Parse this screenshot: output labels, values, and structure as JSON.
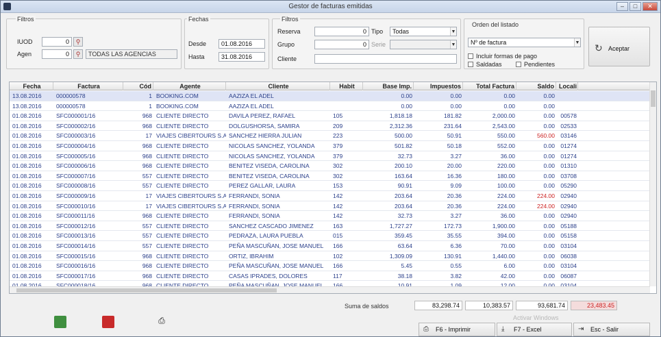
{
  "window": {
    "title": "Gestor de facturas emitidas",
    "min": "–",
    "max": "□",
    "close": "✕"
  },
  "filters": {
    "grupo_titulo": "Filtros",
    "iuod_label": "IUOD",
    "iuod_value": "0",
    "agen_label": "Agen",
    "agen_value": "0",
    "agen_name": "TODAS LAS AGENCIAS",
    "fechas_titulo": "Fechas",
    "desde_label": "Desde",
    "desde_value": "01.08.2016",
    "hasta_label": "Hasta",
    "hasta_value": "31.08.2016",
    "filtro2_titulo": "Filtros",
    "reserva_label": "Reserva",
    "reserva_value": "0",
    "tipo_label": "Tipo",
    "tipo_value": "Todas",
    "grupo_label": "Grupo",
    "grupo_value": "0",
    "serie_label": "Serie",
    "cliente_label": "Cliente",
    "orden_titulo": "Orden del listado",
    "orden_value": "Nº de factura",
    "incluir_label": "Incluir formas de pago",
    "saldadas_label": "Saldadas",
    "pendientes_label": "Pendientes",
    "aceptar_label": "Aceptar"
  },
  "table": {
    "columns": [
      "Fecha",
      "Factura",
      "Cód",
      "Agente",
      "Cliente",
      "Habit",
      "Base Imp.",
      "Impuestos",
      "Total Factura",
      "Saldo",
      "Locali"
    ],
    "rows": [
      [
        "13.08.2016",
        "000000578",
        "1",
        "BOOKING.COM",
        "AAZIZA EL ADEL",
        "",
        "0.00",
        "0.00",
        "0.00",
        "0.00",
        ""
      ],
      [
        "13.08.2016",
        "000000578",
        "1",
        "BOOKING.COM",
        "AAZIZA EL ADEL",
        "",
        "0.00",
        "0.00",
        "0.00",
        "0.00",
        ""
      ],
      [
        "01.08.2016",
        "SFC000001/16",
        "968",
        "CLIENTE DIRECTO",
        "DAVILA PEREZ, RAFAEL",
        "105",
        "1,818.18",
        "181.82",
        "2,000.00",
        "0.00",
        "00578"
      ],
      [
        "01.08.2016",
        "SFC000002/16",
        "968",
        "CLIENTE DIRECTO",
        "DOLGUSHORSA, SAMIRA",
        "209",
        "2,312.36",
        "231.64",
        "2,543.00",
        "0.00",
        "02533"
      ],
      [
        "01.08.2016",
        "SFC000003/16",
        "17",
        "VIAJES CIBERTOURS S.A.",
        "SANCHEZ HIERRA JULIAN",
        "223",
        "500.00",
        "50.91",
        "550.00",
        "560.00",
        "03146"
      ],
      [
        "01.08.2016",
        "SFC000004/16",
        "968",
        "CLIENTE DIRECTO",
        "NICOLAS SANCHEZ, YOLANDA",
        "379",
        "501.82",
        "50.18",
        "552.00",
        "0.00",
        "01274"
      ],
      [
        "01.08.2016",
        "SFC000005/16",
        "968",
        "CLIENTE DIRECTO",
        "NICOLAS SANCHEZ, YOLANDA",
        "379",
        "32.73",
        "3.27",
        "36.00",
        "0.00",
        "01274"
      ],
      [
        "01.08.2016",
        "SFC000006/16",
        "968",
        "CLIENTE DIRECTO",
        "BENITEZ VISEDA, CAROLINA",
        "302",
        "200.10",
        "20.00",
        "220.00",
        "0.00",
        "01310"
      ],
      [
        "01.08.2016",
        "SFC000007/16",
        "557",
        "CLIENTE DIRECTO",
        "BENITEZ VISEDA, CAROLINA",
        "302",
        "163.64",
        "16.36",
        "180.00",
        "0.00",
        "03708"
      ],
      [
        "01.08.2016",
        "SFC000008/16",
        "557",
        "CLIENTE DIRECTO",
        "PEREZ GALLAR, LAURA",
        "153",
        "90.91",
        "9.09",
        "100.00",
        "0.00",
        "05290"
      ],
      [
        "01.08.2016",
        "SFC000009/16",
        "17",
        "VIAJES CIBERTOURS S.A.",
        "FERRANDI, SONIA",
        "142",
        "203.64",
        "20.36",
        "224.00",
        "224.00",
        "02940"
      ],
      [
        "01.08.2016",
        "SFC000010/16",
        "17",
        "VIAJES CIBERTOURS S.A.",
        "FERRANDI, SONIA",
        "142",
        "203.64",
        "20.36",
        "224.00",
        "224.00",
        "02940"
      ],
      [
        "01.08.2016",
        "SFC000011/16",
        "968",
        "CLIENTE DIRECTO",
        "FERRANDI, SONIA",
        "142",
        "32.73",
        "3.27",
        "36.00",
        "0.00",
        "02940"
      ],
      [
        "01.08.2016",
        "SFC000012/16",
        "557",
        "CLIENTE DIRECTO",
        "SANCHEZ CASCADO JIMENEZ",
        "163",
        "1,727.27",
        "172.73",
        "1,900.00",
        "0.00",
        "05188"
      ],
      [
        "01.08.2016",
        "SFC000013/16",
        "557",
        "CLIENTE DIRECTO",
        "PEDRAZA, LAURA PUEBLA",
        "015",
        "359.45",
        "35.55",
        "394.00",
        "0.00",
        "05158"
      ],
      [
        "01.08.2016",
        "SFC000014/16",
        "557",
        "CLIENTE DIRECTO",
        "PEÑA MASCUÑAN, JOSE MANUEL",
        "166",
        "63.64",
        "6.36",
        "70.00",
        "0.00",
        "03104"
      ],
      [
        "01.08.2016",
        "SFC000015/16",
        "968",
        "CLIENTE DIRECTO",
        "ORTIZ, IBRAHIM",
        "102",
        "1,309.09",
        "130.91",
        "1,440.00",
        "0.00",
        "06038"
      ],
      [
        "01.08.2016",
        "SFC000016/16",
        "968",
        "CLIENTE DIRECTO",
        "PEÑA MASCUÑAN, JOSE MANUEL",
        "166",
        "5.45",
        "0.55",
        "6.00",
        "0.00",
        "03104"
      ],
      [
        "01.08.2016",
        "SFC000017/16",
        "968",
        "CLIENTE DIRECTO",
        "CASAS IPRADES, DOLORES",
        "117",
        "38.18",
        "3.82",
        "42.00",
        "0.00",
        "06087"
      ],
      [
        "01.08.2016",
        "SFC000018/16",
        "968",
        "CLIENTE DIRECTO",
        "PEÑA MASCUÑAN, JOSE MANUEL",
        "166",
        "10.91",
        "1.09",
        "12.00",
        "0.00",
        "03104"
      ]
    ]
  },
  "totals": {
    "label": "Suma de saldos",
    "base": "83,298.74",
    "impuestos": "10,383.57",
    "total": "93,681.74",
    "saldo": "23,483.45"
  },
  "footer": {
    "imprimir_label": "F6 - Imprimir",
    "excel_label": "F7 - Excel",
    "salir_label": "Esc - Salir",
    "watermark": "Activar Windows"
  },
  "colors": {
    "title_bg": "#c7d5e9",
    "row_text": "#2a3f8a",
    "selected_row": "#dfe4f5",
    "negative": "#c22"
  }
}
